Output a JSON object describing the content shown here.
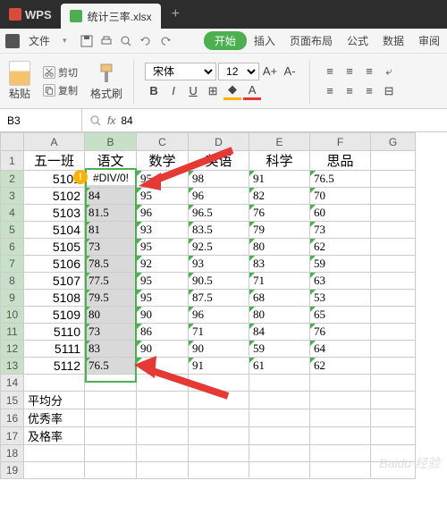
{
  "title_bar": {
    "app_name": "WPS",
    "file_tab": "统计三率.xlsx",
    "new_tab_icon": "+"
  },
  "menu_bar": {
    "file_label": "文件",
    "items": [
      "开始",
      "插入",
      "页面布局",
      "公式",
      "数据",
      "审阅"
    ]
  },
  "ribbon": {
    "paste_label": "粘贴",
    "cut_label": "剪切",
    "copy_label": "复制",
    "format_painter_label": "格式刷",
    "font_name": "宋体",
    "font_size": "12",
    "bold": "B",
    "italic": "I",
    "underline": "U",
    "font_increase": "A+",
    "font_decrease": "A-"
  },
  "formula_bar": {
    "name_box": "B3",
    "fx_label": "fx",
    "formula_value": "84"
  },
  "columns": [
    "A",
    "B",
    "C",
    "D",
    "E",
    "F",
    "G"
  ],
  "headers": {
    "A": "五一班",
    "B": "语文",
    "C": "数学",
    "D": "英语",
    "E": "科学",
    "F": "思品"
  },
  "rows": [
    {
      "n": "2",
      "A": "5101",
      "B": "#DIV/0!",
      "C": "95",
      "D": "98",
      "E": "91",
      "F": "76.5"
    },
    {
      "n": "3",
      "A": "5102",
      "B": "84",
      "C": "95",
      "D": "96",
      "E": "82",
      "F": "70"
    },
    {
      "n": "4",
      "A": "5103",
      "B": "81.5",
      "C": "96",
      "D": "96.5",
      "E": "76",
      "F": "60"
    },
    {
      "n": "5",
      "A": "5104",
      "B": "81",
      "C": "93",
      "D": "83.5",
      "E": "79",
      "F": "73"
    },
    {
      "n": "6",
      "A": "5105",
      "B": "73",
      "C": "95",
      "D": "92.5",
      "E": "80",
      "F": "62"
    },
    {
      "n": "7",
      "A": "5106",
      "B": "78.5",
      "C": "92",
      "D": "93",
      "E": "83",
      "F": "59"
    },
    {
      "n": "8",
      "A": "5107",
      "B": "77.5",
      "C": "95",
      "D": "90.5",
      "E": "71",
      "F": "63"
    },
    {
      "n": "9",
      "A": "5108",
      "B": "79.5",
      "C": "95",
      "D": "87.5",
      "E": "68",
      "F": "53"
    },
    {
      "n": "10",
      "A": "5109",
      "B": "80",
      "C": "90",
      "D": "96",
      "E": "80",
      "F": "65"
    },
    {
      "n": "11",
      "A": "5110",
      "B": "73",
      "C": "86",
      "D": "71",
      "E": "84",
      "F": "76"
    },
    {
      "n": "12",
      "A": "5111",
      "B": "83",
      "C": "90",
      "D": "90",
      "E": "59",
      "F": "64"
    },
    {
      "n": "13",
      "A": "5112",
      "B": "76.5",
      "C": "94",
      "D": "91",
      "E": "61",
      "F": "62"
    }
  ],
  "footer_rows": [
    {
      "n": "14",
      "A": ""
    },
    {
      "n": "15",
      "A": "平均分"
    },
    {
      "n": "16",
      "A": "优秀率"
    },
    {
      "n": "17",
      "A": "及格率"
    },
    {
      "n": "18",
      "A": ""
    },
    {
      "n": "19",
      "A": ""
    }
  ],
  "watermark": "Baidu 经验"
}
